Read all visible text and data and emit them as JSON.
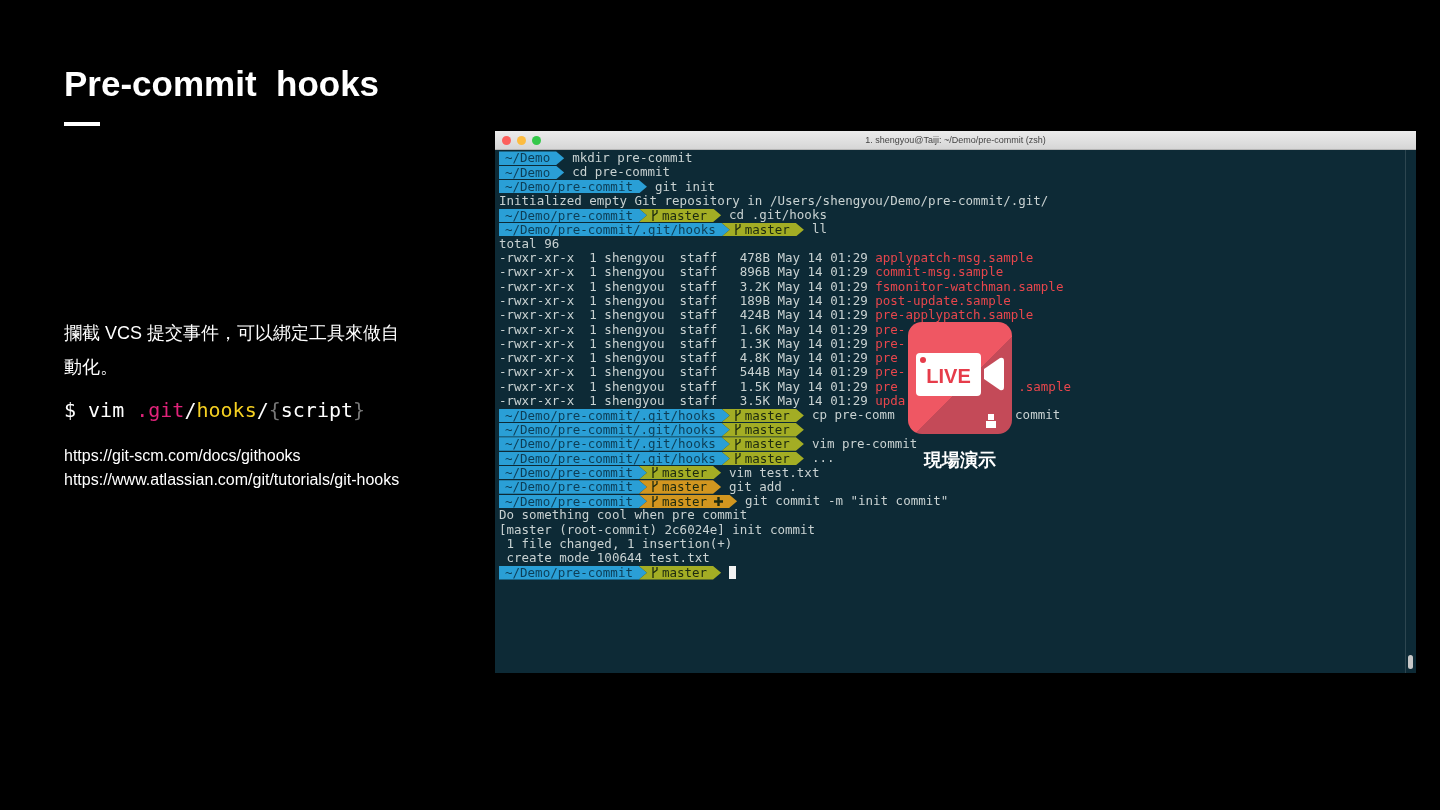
{
  "slide": {
    "title": "Pre-commit  hooks",
    "description": "攔截 VCS 提交事件，可以綁定工具來做自動化。",
    "code_tokens": [
      {
        "text": "$ vim ",
        "color": "#ffffff"
      },
      {
        "text": ".git",
        "color": "#e0237a"
      },
      {
        "text": "/",
        "color": "#ffffff"
      },
      {
        "text": "hooks",
        "color": "#f5d021"
      },
      {
        "text": "/",
        "color": "#ffffff"
      },
      {
        "text": "{",
        "color": "#777777"
      },
      {
        "text": "script",
        "color": "#ffffff"
      },
      {
        "text": "}",
        "color": "#777777"
      }
    ],
    "links": [
      "https://git-scm.com/docs/githooks",
      "https://www.atlassian.com/git/tutorials/git-hooks"
    ]
  },
  "terminal": {
    "title": "1. shengyou@Taiji: ~/Demo/pre-commit (zsh)",
    "lines": [
      {
        "kind": "prompt",
        "path": "~/Demo",
        "command": "mkdir pre-commit"
      },
      {
        "kind": "prompt",
        "path": "~/Demo",
        "command": "cd pre-commit"
      },
      {
        "kind": "prompt",
        "path": "~/Demo/pre-commit",
        "command": "git init"
      },
      {
        "kind": "output",
        "text": "Initialized empty Git repository in /Users/shengyou/Demo/pre-commit/.git/"
      },
      {
        "kind": "prompt",
        "path": "~/Demo/pre-commit",
        "branch": "master",
        "dirty": false,
        "staged": false,
        "command": "cd .git/hooks"
      },
      {
        "kind": "prompt",
        "path": "~/Demo/pre-commit/.git/hooks",
        "branch": "master",
        "dirty": false,
        "staged": false,
        "command": "ll"
      },
      {
        "kind": "output",
        "text": "total 96"
      },
      {
        "kind": "file",
        "info": "-rwxr-xr-x  1 shengyou  staff   478B May 14 01:29",
        "name": "applypatch-msg.sample"
      },
      {
        "kind": "file",
        "info": "-rwxr-xr-x  1 shengyou  staff   896B May 14 01:29",
        "name": "commit-msg.sample"
      },
      {
        "kind": "file",
        "info": "-rwxr-xr-x  1 shengyou  staff   3.2K May 14 01:29",
        "name": "fsmonitor-watchman.sample"
      },
      {
        "kind": "file",
        "info": "-rwxr-xr-x  1 shengyou  staff   189B May 14 01:29",
        "name": "post-update.sample"
      },
      {
        "kind": "file",
        "info": "-rwxr-xr-x  1 shengyou  staff   424B May 14 01:29",
        "name": "pre-applypatch.sample"
      },
      {
        "kind": "file",
        "info": "-rwxr-xr-x  1 shengyou  staff   1.6K May 14 01:29",
        "name": "pre-"
      },
      {
        "kind": "file",
        "info": "-rwxr-xr-x  1 shengyou  staff   1.3K May 14 01:29",
        "name": "pre-"
      },
      {
        "kind": "file",
        "info": "-rwxr-xr-x  1 shengyou  staff   4.8K May 14 01:29",
        "name": "pre"
      },
      {
        "kind": "file",
        "info": "-rwxr-xr-x  1 shengyou  staff   544B May 14 01:29",
        "name": "pre-"
      },
      {
        "kind": "file",
        "info": "-rwxr-xr-x  1 shengyou  staff   1.5K May 14 01:29",
        "name": "pre",
        "name_tail": ".sample"
      },
      {
        "kind": "file",
        "info": "-rwxr-xr-x  1 shengyou  staff   3.5K May 14 01:29",
        "name": "upda"
      },
      {
        "kind": "prompt",
        "path": "~/Demo/pre-commit/.git/hooks",
        "branch": "master",
        "dirty": false,
        "staged": false,
        "command": "cp pre-comm",
        "command_tail": "commit"
      },
      {
        "kind": "prompt",
        "path": "~/Demo/pre-commit/.git/hooks",
        "branch": "master",
        "dirty": false,
        "staged": false
      },
      {
        "kind": "prompt",
        "path": "~/Demo/pre-commit/.git/hooks",
        "branch": "master",
        "dirty": false,
        "staged": false,
        "command": "vim pre-commit"
      },
      {
        "kind": "prompt",
        "path": "~/Demo/pre-commit/.git/hooks",
        "branch": "master",
        "dirty": false,
        "staged": false,
        "command": "..."
      },
      {
        "kind": "prompt",
        "path": "~/Demo/pre-commit",
        "branch": "master",
        "dirty": false,
        "staged": false,
        "command": "vim test.txt"
      },
      {
        "kind": "prompt",
        "path": "~/Demo/pre-commit",
        "branch": "master",
        "dirty": true,
        "staged": false,
        "command": "git add ."
      },
      {
        "kind": "prompt",
        "path": "~/Demo/pre-commit",
        "branch": "master",
        "dirty": true,
        "staged": true,
        "command": "git commit -m \"init commit\""
      },
      {
        "kind": "output",
        "text": "Do something cool when pre commit"
      },
      {
        "kind": "output",
        "text": "[master (root-commit) 2c6024e] init commit"
      },
      {
        "kind": "output",
        "text": " 1 file changed, 1 insertion(+)"
      },
      {
        "kind": "output",
        "text": " create mode 100644 test.txt"
      },
      {
        "kind": "prompt",
        "path": "~/Demo/pre-commit",
        "branch": "master",
        "dirty": false,
        "staged": false,
        "cursor": true
      }
    ]
  },
  "live_badge": {
    "label": "LIVE",
    "caption": "現場演示"
  }
}
